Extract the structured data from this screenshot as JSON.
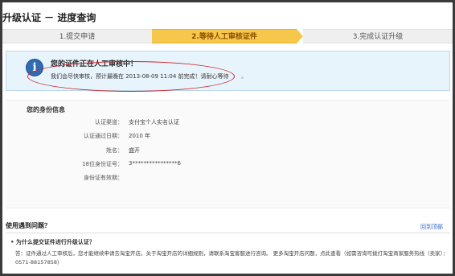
{
  "page": {
    "title": "升级认证 － 进度查询"
  },
  "steps": [
    {
      "label": "1.提交申请"
    },
    {
      "label": "2.等待人工审核证件"
    },
    {
      "label": "3.完成认证升级"
    }
  ],
  "notice": {
    "icon": "info-icon",
    "icon_glyph": "i",
    "title": "您的证件正在人工审核中！",
    "message": "我们会尽快审核，预计最晚在 2013-08-09 11:04 前完成！请耐心等待",
    "trailing": "。"
  },
  "identity": {
    "section_title": "您的身份信息",
    "rows": [
      {
        "label": "认证渠道：",
        "value": "支付宝个人实名认证"
      },
      {
        "label": "认证通过日期：",
        "value": "2010 年"
      },
      {
        "label": "姓名：",
        "value": "盛开"
      },
      {
        "label": "18位身份证号：",
        "value": "3****************6"
      },
      {
        "label": "身份证有效期：",
        "value": ""
      }
    ]
  },
  "help": {
    "title": "使用遇到问题？",
    "back_to_top": "回到顶部",
    "question": "• 为什么提交证件进行升级认证？",
    "answer": "答：证件通过人工审核后，您才能继续申请去淘宝开店。关于淘宝开店的详细规则，请联系淘宝客服进行咨询。 更多淘宝开店问题，点此查看（如需咨询可拨打淘宝商家服务热线（卖家）：0571-88157858）"
  },
  "colors": {
    "active_step": "#f5c84c",
    "notice_bg": "#e8f4fc",
    "highlight": "#d0202a",
    "link": "#3366cc"
  }
}
